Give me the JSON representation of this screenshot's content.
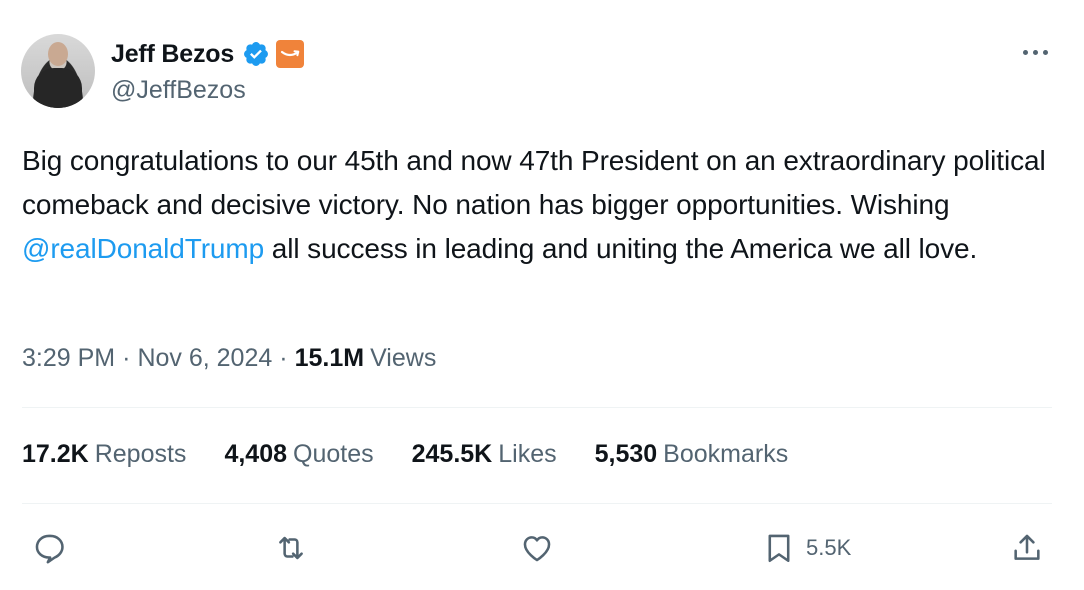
{
  "author": {
    "display_name": "Jeff Bezos",
    "handle": "@JeffBezos",
    "verified_icon": "verified-badge-icon",
    "affiliation_icon": "amazon-logo-icon",
    "verified_color": "#1d9bf0",
    "affiliation_color": "#f0833a"
  },
  "tweet": {
    "text_before": "Big congratulations to our 45th and now 47th President on an extraordinary political comeback and decisive victory. No nation has bigger opportunities. Wishing ",
    "mention": "@realDonaldTrump",
    "text_after": " all success in leading and uniting the America we all love."
  },
  "meta": {
    "time": "3:29 PM",
    "separator": "·",
    "date": "Nov 6, 2024",
    "views_count": "15.1M",
    "views_label": "Views"
  },
  "stats": [
    {
      "count": "17.2K",
      "label": "Reposts"
    },
    {
      "count": "4,408",
      "label": "Quotes"
    },
    {
      "count": "245.5K",
      "label": "Likes"
    },
    {
      "count": "5,530",
      "label": "Bookmarks"
    }
  ],
  "actions": {
    "reply_icon": "reply-icon",
    "repost_icon": "repost-icon",
    "like_icon": "like-icon",
    "bookmark_icon": "bookmark-icon",
    "bookmark_count": "5.5K",
    "share_icon": "share-icon"
  },
  "colors": {
    "text": "#0f1419",
    "secondary": "#536471",
    "link": "#1d9bf0",
    "divider": "#eff3f4"
  }
}
